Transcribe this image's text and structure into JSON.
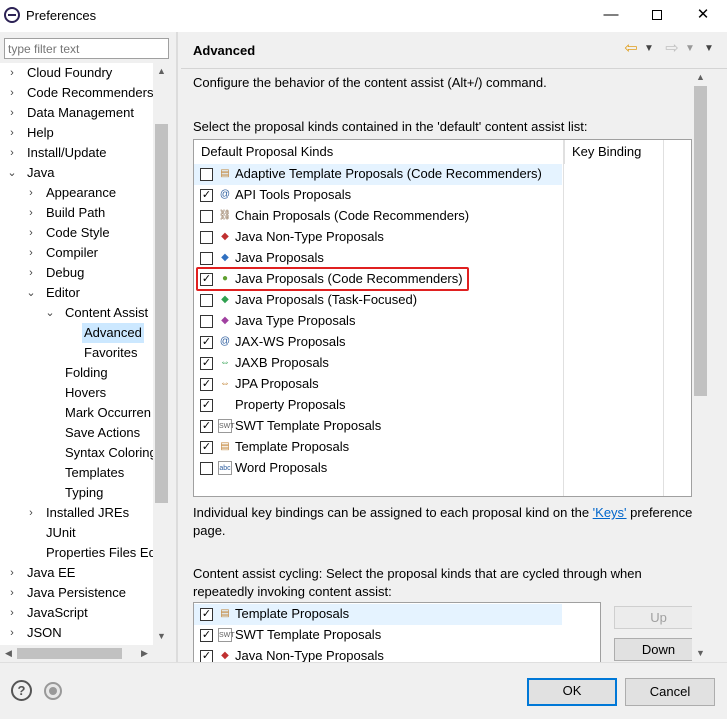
{
  "window": {
    "title": "Preferences",
    "minimize": "—",
    "close": "✕"
  },
  "filter": {
    "placeholder": "type filter text"
  },
  "tree": [
    {
      "label": "Cloud Foundry",
      "chevron": "›",
      "selected": false
    },
    {
      "label": "Code Recommenders",
      "chevron": "›",
      "selected": false
    },
    {
      "label": "Data Management",
      "chevron": "›",
      "selected": false
    },
    {
      "label": "Help",
      "chevron": "›",
      "selected": false
    },
    {
      "label": "Install/Update",
      "chevron": "›",
      "selected": false
    },
    {
      "label": "Java",
      "chevron": "⌄",
      "selected": false
    },
    {
      "label": "Appearance",
      "chevron": "›",
      "selected": false
    },
    {
      "label": "Build Path",
      "chevron": "›",
      "selected": false
    },
    {
      "label": "Code Style",
      "chevron": "›",
      "selected": false
    },
    {
      "label": "Compiler",
      "chevron": "›",
      "selected": false
    },
    {
      "label": "Debug",
      "chevron": "›",
      "selected": false
    },
    {
      "label": "Editor",
      "chevron": "⌄",
      "selected": false
    },
    {
      "label": "Content Assist",
      "chevron": "⌄",
      "selected": false
    },
    {
      "label": "Advanced",
      "chevron": "",
      "selected": true
    },
    {
      "label": "Favorites",
      "chevron": "",
      "selected": false
    },
    {
      "label": "Folding",
      "chevron": "",
      "selected": false
    },
    {
      "label": "Hovers",
      "chevron": "",
      "selected": false
    },
    {
      "label": "Mark Occurren",
      "chevron": "",
      "selected": false
    },
    {
      "label": "Save Actions",
      "chevron": "",
      "selected": false
    },
    {
      "label": "Syntax Coloring",
      "chevron": "",
      "selected": false
    },
    {
      "label": "Templates",
      "chevron": "",
      "selected": false
    },
    {
      "label": "Typing",
      "chevron": "",
      "selected": false
    },
    {
      "label": "Installed JREs",
      "chevron": "›",
      "selected": false
    },
    {
      "label": "JUnit",
      "chevron": "",
      "selected": false
    },
    {
      "label": "Properties Files Ed",
      "chevron": "",
      "selected": false
    },
    {
      "label": "Java EE",
      "chevron": "›",
      "selected": false
    },
    {
      "label": "Java Persistence",
      "chevron": "›",
      "selected": false
    },
    {
      "label": "JavaScript",
      "chevron": "›",
      "selected": false
    },
    {
      "label": "JSON",
      "chevron": "›",
      "selected": false
    }
  ],
  "page": {
    "title": "Advanced",
    "description": "Configure the behavior of the content assist (Alt+/) command.",
    "select_label": "Select the proposal kinds contained in the 'default' content assist list:",
    "columns": [
      "Default Proposal Kinds",
      "Key Binding"
    ],
    "proposals": [
      {
        "label": "Adaptive Template Proposals (Code Recommenders)",
        "checked": false,
        "icon": "template-icon",
        "glyph": "▤",
        "color": "#c08030"
      },
      {
        "label": "API Tools Proposals",
        "checked": true,
        "icon": "at-icon",
        "glyph": "@",
        "color": "#3060a0"
      },
      {
        "label": "Chain Proposals (Code Recommenders)",
        "checked": false,
        "icon": "chain-icon",
        "glyph": "⛓",
        "color": "#806040"
      },
      {
        "label": "Java Non-Type Proposals",
        "checked": false,
        "icon": "shapes-icon",
        "glyph": "◆",
        "color": "#c03030"
      },
      {
        "label": "Java Proposals",
        "checked": false,
        "icon": "shapes-icon",
        "glyph": "◆",
        "color": "#3070c0"
      },
      {
        "label": "Java Proposals (Code Recommenders)",
        "checked": true,
        "icon": "recommender-icon",
        "glyph": "●",
        "color": "#60a030"
      },
      {
        "label": "Java Proposals (Task-Focused)",
        "checked": false,
        "icon": "shapes-icon",
        "glyph": "◆",
        "color": "#30a050"
      },
      {
        "label": "Java Type Proposals",
        "checked": false,
        "icon": "shapes-icon",
        "glyph": "◆",
        "color": "#a040a0"
      },
      {
        "label": "JAX-WS Proposals",
        "checked": true,
        "icon": "at-icon",
        "glyph": "@",
        "color": "#3060a0"
      },
      {
        "label": "JAXB Proposals",
        "checked": true,
        "icon": "arrows-icon",
        "glyph": "⇔",
        "color": "#30a050"
      },
      {
        "label": "JPA Proposals",
        "checked": true,
        "icon": "arrows-icon",
        "glyph": "⇔",
        "color": "#c08030"
      },
      {
        "label": "Property Proposals",
        "checked": true,
        "icon": "",
        "glyph": "",
        "color": "#000000"
      },
      {
        "label": "SWT Template Proposals",
        "checked": true,
        "icon": "swt-icon",
        "glyph": "SWT",
        "color": "#606060"
      },
      {
        "label": "Template Proposals",
        "checked": true,
        "icon": "template-icon",
        "glyph": "▤",
        "color": "#c08030"
      },
      {
        "label": "Word Proposals",
        "checked": false,
        "icon": "word-icon",
        "glyph": "abc",
        "color": "#3060a0"
      }
    ],
    "keys_text_before": "Individual key bindings can be assigned to each proposal kind on the ",
    "keys_link": "'Keys'",
    "keys_text_after": " preference page.",
    "cycle_label": "Content assist cycling: Select the proposal kinds that are cycled through when repeatedly invoking content assist:",
    "cycle_items": [
      {
        "label": "Template Proposals",
        "checked": true,
        "icon": "template-icon",
        "glyph": "▤",
        "color": "#c08030"
      },
      {
        "label": "SWT Template Proposals",
        "checked": true,
        "icon": "swt-icon",
        "glyph": "SWT",
        "color": "#606060"
      },
      {
        "label": "Java Non-Type Proposals",
        "checked": true,
        "icon": "shapes-icon",
        "glyph": "◆",
        "color": "#c03030"
      }
    ],
    "up_button": "Up",
    "down_button": "Down"
  },
  "footer": {
    "help_glyph": "?",
    "ok": "OK",
    "cancel": "Cancel"
  },
  "colors": {
    "accent": "#0078d7",
    "selection": "#cce8ff",
    "highlight_box": "#e02020",
    "link": "#0066cc"
  }
}
